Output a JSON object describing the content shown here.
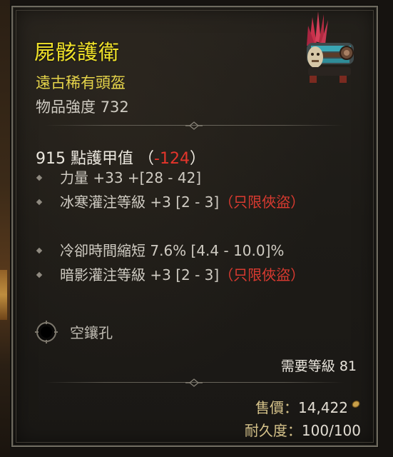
{
  "item": {
    "name": "屍骸護衛",
    "type": "遠古稀有頭盔",
    "power_label": "物品強度",
    "power_value": "732",
    "icon": "helm-icon"
  },
  "armor": {
    "value": "915",
    "label": "點護甲值",
    "open": "（",
    "delta": "-124",
    "close": "）"
  },
  "affixes": [
    {
      "text": "力量 +33 +[28 - 42]",
      "restriction": ""
    },
    {
      "text": "冰寒灌注等級 +3 [2 - 3]",
      "restriction": "（只限俠盜）"
    },
    {
      "text": "冷卻時間縮短 7.6% [4.4 - 10.0]%",
      "restriction": ""
    },
    {
      "text": "暗影灌注等級 +3 [2 - 3]",
      "restriction": "（只限俠盜）"
    }
  ],
  "socket": {
    "label": "空鑲孔",
    "icon": "empty-socket-icon"
  },
  "requirement": {
    "label": "需要等級",
    "value": "81"
  },
  "sell": {
    "label": "售價：",
    "value": "14,422",
    "icon": "gold-coin-icon"
  },
  "durability": {
    "label": "耐久度：",
    "value": "100/100"
  },
  "colors": {
    "rare_name": "#f0e22a",
    "rare_type": "#e6d44a",
    "negative": "#e5352b",
    "restriction": "#d93a30",
    "text": "#cfcbc2",
    "frame": "#6e6a5f",
    "background": "#1d1b17"
  }
}
